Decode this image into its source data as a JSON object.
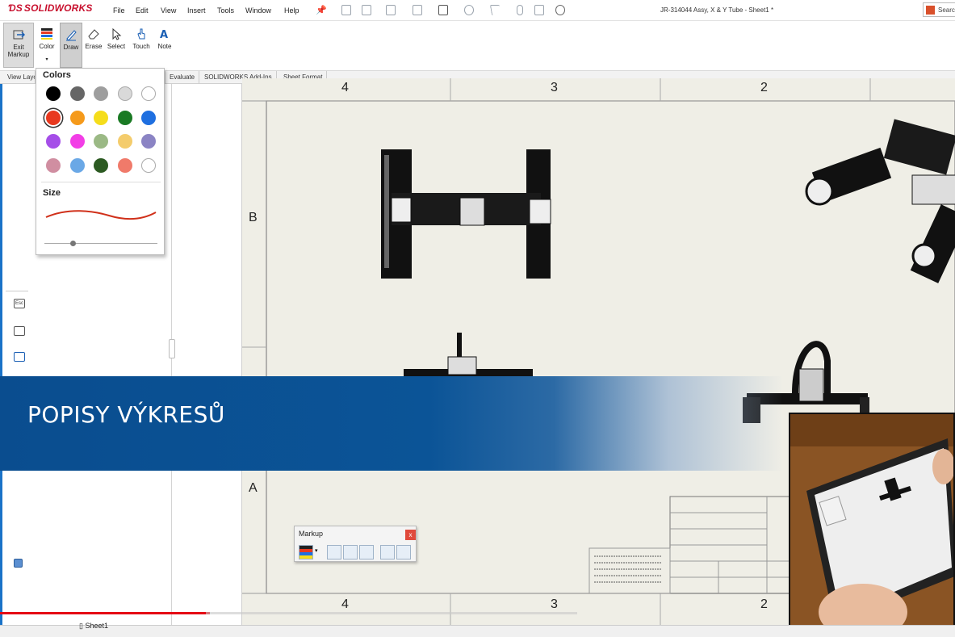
{
  "app": {
    "logo_text": "SOLIDWORKS",
    "window_title": "JR-314044 Assy, X & Y Tube - Sheet1 *",
    "search_text": "Searc"
  },
  "menu": [
    "File",
    "Edit",
    "View",
    "Insert",
    "Tools",
    "Window",
    "Help"
  ],
  "ribbon": {
    "exit_label_1": "Exit",
    "exit_label_2": "Markup",
    "color_label": "Color",
    "draw_label": "Draw",
    "erase_label": "Erase",
    "select_label": "Select",
    "touch_label": "Touch",
    "note_label": "Note"
  },
  "tabs": [
    "View Layout",
    "Evaluate",
    "SOLIDWORKS Add-Ins",
    "Sheet Format"
  ],
  "colors_popup": {
    "title": "Colors",
    "size_title": "Size",
    "swatches": [
      "#000000",
      "#666666",
      "#9e9e9e",
      "#d9d9d9",
      "#ffffff",
      "#e8391f",
      "#f59a1b",
      "#f5dd1b",
      "#1a7a24",
      "#1f6fe0",
      "#a54ee8",
      "#f23ee6",
      "#9bb985",
      "#f4cc6c",
      "#8b84c4",
      "#d08ea1",
      "#6aa8e6",
      "#2c5a22",
      "#f07a6a",
      "#ffffff"
    ],
    "selected_index": 5,
    "stroke_color": "#d0301a",
    "size_level": 0.25
  },
  "drawing": {
    "zones_top": [
      "4",
      "3",
      "2"
    ],
    "zones_bottom": [
      "4",
      "3",
      "2"
    ],
    "zones_left": [
      "B",
      "A"
    ]
  },
  "markup_toolbar": {
    "title": "Markup",
    "close_glyph": "x"
  },
  "banner": {
    "text": "POPISY VÝKRESŮ",
    "color": "#0a4d8f"
  },
  "bottom": {
    "sheet_tab": "Sheet1",
    "progress": 0.22
  }
}
